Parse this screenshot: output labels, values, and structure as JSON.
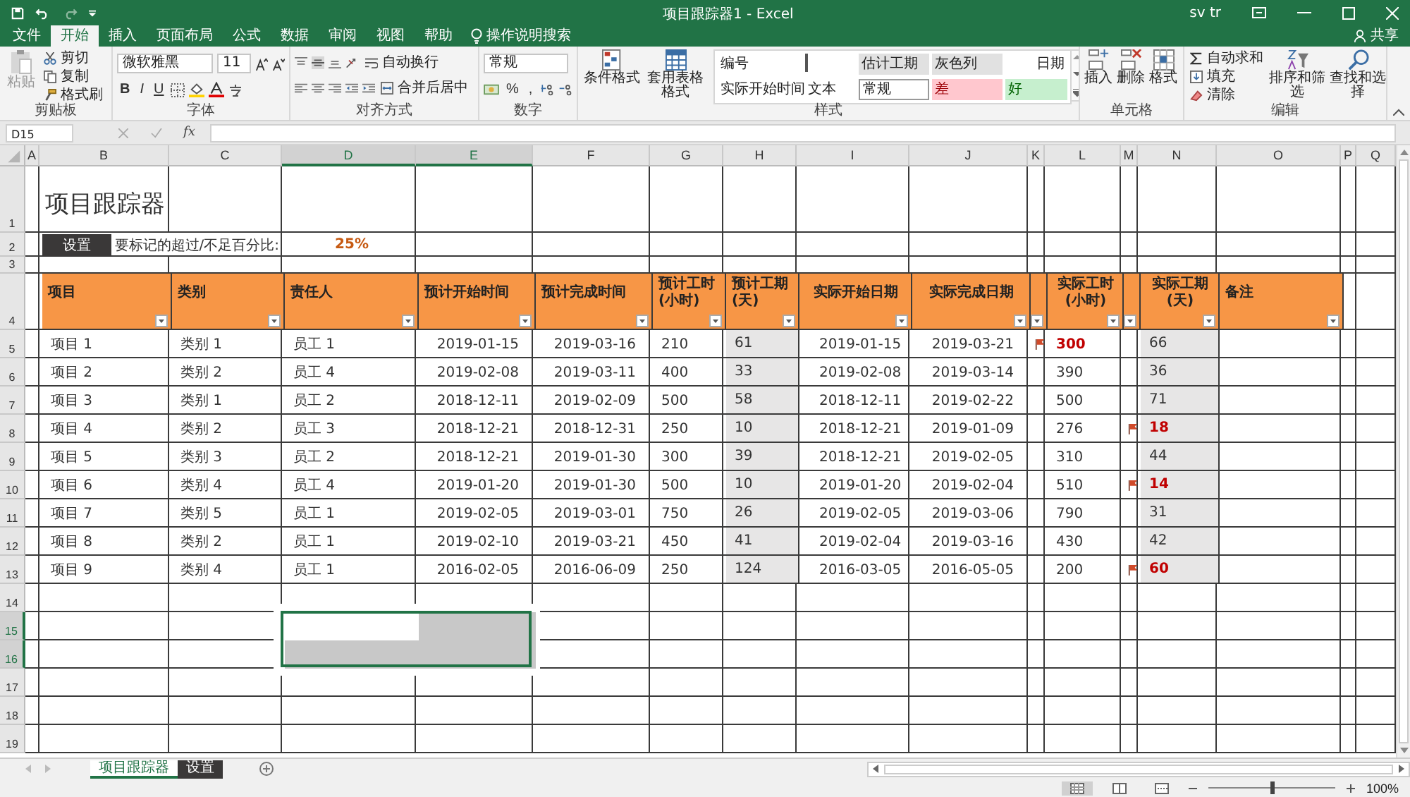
{
  "window": {
    "title": "项目跟踪器1  -  Excel",
    "user": "sv tr"
  },
  "ribbon_tabs": [
    {
      "label": "文件",
      "selected": false
    },
    {
      "label": "开始",
      "selected": true
    },
    {
      "label": "插入",
      "selected": false
    },
    {
      "label": "页面布局",
      "selected": false
    },
    {
      "label": "公式",
      "selected": false
    },
    {
      "label": "数据",
      "selected": false
    },
    {
      "label": "审阅",
      "selected": false
    },
    {
      "label": "视图",
      "selected": false
    },
    {
      "label": "帮助",
      "selected": false
    }
  ],
  "tell_me": "操作说明搜索",
  "share": "共享",
  "ribbon": {
    "clipboard": {
      "paste": {
        "label": "粘贴",
        "disabled": true
      },
      "cut": "剪切",
      "copy": "复制",
      "format_painter": "格式刷",
      "label": "剪贴板"
    },
    "font": {
      "name": "微软雅黑",
      "size": "11",
      "bold": "B",
      "italic": "I",
      "underline": "U",
      "label": "字体"
    },
    "alignment": {
      "wrap": "自动换行",
      "merge": "合并后居中",
      "label": "对齐方式"
    },
    "number": {
      "format": "常规",
      "percent": "%",
      "comma": ",",
      "label": "数字"
    },
    "styles": {
      "conditional": "条件格式",
      "table": "套用表格格式",
      "gallery": [
        {
          "label": "编号",
          "kind": "plain"
        },
        {
          "kind": "marker"
        },
        {
          "label": "估计工期",
          "kind": "gray"
        },
        {
          "label": "灰色列",
          "kind": "gray"
        },
        {
          "label": "日期",
          "kind": "right"
        },
        {
          "label": "实际开始时间",
          "kind": "plain"
        },
        {
          "label": "文本",
          "kind": "plain"
        },
        {
          "label": "常规",
          "kind": "normal"
        },
        {
          "label": "差",
          "kind": "bad"
        },
        {
          "label": "好",
          "kind": "good"
        }
      ],
      "label": "样式"
    },
    "cells": {
      "insert": "插入",
      "delete": "删除",
      "format": "格式",
      "label": "单元格"
    },
    "editing": {
      "autosum": "自动求和",
      "fill": "填充",
      "clear": "清除",
      "sort": "排序和筛选",
      "find": "查找和选择",
      "label": "编辑"
    }
  },
  "formula_bar": {
    "name_box": "D15",
    "function_label": "fx"
  },
  "columns": [
    {
      "letter": "A",
      "selected": false
    },
    {
      "letter": "B",
      "selected": false
    },
    {
      "letter": "C",
      "selected": false
    },
    {
      "letter": "D",
      "selected": true
    },
    {
      "letter": "E",
      "selected": true
    },
    {
      "letter": "F",
      "selected": false
    },
    {
      "letter": "G",
      "selected": false
    },
    {
      "letter": "H",
      "selected": false
    },
    {
      "letter": "I",
      "selected": false
    },
    {
      "letter": "J",
      "selected": false
    },
    {
      "letter": "K",
      "selected": false
    },
    {
      "letter": "L",
      "selected": false
    },
    {
      "letter": "M",
      "selected": false
    },
    {
      "letter": "N",
      "selected": false
    },
    {
      "letter": "O",
      "selected": false
    },
    {
      "letter": "P",
      "selected": false
    },
    {
      "letter": "Q",
      "selected": false
    }
  ],
  "row_numbers": [
    {
      "label": "1",
      "selected": false
    },
    {
      "label": "2",
      "selected": false
    },
    {
      "label": "3",
      "selected": false
    },
    {
      "label": "4",
      "selected": false
    },
    {
      "label": "5",
      "selected": false
    },
    {
      "label": "6",
      "selected": false
    },
    {
      "label": "7",
      "selected": false
    },
    {
      "label": "8",
      "selected": false
    },
    {
      "label": "9",
      "selected": false
    },
    {
      "label": "10",
      "selected": false
    },
    {
      "label": "11",
      "selected": false
    },
    {
      "label": "12",
      "selected": false
    },
    {
      "label": "13",
      "selected": false
    },
    {
      "label": "14",
      "selected": false
    },
    {
      "label": "15",
      "selected": true
    },
    {
      "label": "16",
      "selected": true
    },
    {
      "label": "17",
      "selected": false
    },
    {
      "label": "18",
      "selected": false
    },
    {
      "label": "19",
      "selected": false
    }
  ],
  "sheet": {
    "title": "项目跟踪器",
    "settings_button": "设置",
    "threshold_label": "要标记的超过/不足百分比:",
    "threshold_value": "25%",
    "headers": [
      {
        "label": "项目",
        "kind": "label"
      },
      {
        "label": "类别",
        "kind": "label"
      },
      {
        "label": "责任人",
        "kind": "label"
      },
      {
        "label": "预计开始时间",
        "kind": "label"
      },
      {
        "label": "预计完成时间",
        "kind": "label"
      },
      {
        "label": "预计工时\n(小时)",
        "kind": "label"
      },
      {
        "label": "预计工期\n(天)",
        "kind": "label"
      },
      {
        "label": "实际开始日期",
        "kind": "centered"
      },
      {
        "label": "实际完成日期",
        "kind": "centered"
      },
      {
        "kind": "flag"
      },
      {
        "label": "实际工时\n(小时)",
        "kind": "centered"
      },
      {
        "kind": "flag"
      },
      {
        "label": "实际工期\n(天)",
        "kind": "centered"
      },
      {
        "label": "备注",
        "kind": "label"
      }
    ],
    "rows": [
      {
        "item": "项目 1",
        "category": "类别 1",
        "owner": "员工 1",
        "planned_start": "2019-01-15",
        "planned_end": "2019-03-16",
        "planned_hours": "210",
        "planned_days": "61",
        "actual_start": "2019-01-15",
        "actual_end": "2019-03-21",
        "hours_flag": true,
        "actual_hours": "300",
        "days_flag": false,
        "actual_days": "66"
      },
      {
        "item": "项目 2",
        "category": "类别 2",
        "owner": "员工 4",
        "planned_start": "2019-02-08",
        "planned_end": "2019-03-11",
        "planned_hours": "400",
        "planned_days": "33",
        "actual_start": "2019-02-08",
        "actual_end": "2019-03-14",
        "hours_flag": false,
        "actual_hours": "390",
        "days_flag": false,
        "actual_days": "36"
      },
      {
        "item": "项目 3",
        "category": "类别 1",
        "owner": "员工 2",
        "planned_start": "2018-12-11",
        "planned_end": "2019-02-09",
        "planned_hours": "500",
        "planned_days": "58",
        "actual_start": "2018-12-11",
        "actual_end": "2019-02-22",
        "hours_flag": false,
        "actual_hours": "500",
        "days_flag": false,
        "actual_days": "71"
      },
      {
        "item": "项目 4",
        "category": "类别 2",
        "owner": "员工 3",
        "planned_start": "2018-12-21",
        "planned_end": "2018-12-31",
        "planned_hours": "250",
        "planned_days": "10",
        "actual_start": "2018-12-21",
        "actual_end": "2019-01-09",
        "hours_flag": false,
        "actual_hours": "276",
        "days_flag": true,
        "actual_days": "18"
      },
      {
        "item": "项目 5",
        "category": "类别 3",
        "owner": "员工 2",
        "planned_start": "2018-12-21",
        "planned_end": "2019-01-30",
        "planned_hours": "300",
        "planned_days": "39",
        "actual_start": "2018-12-21",
        "actual_end": "2019-02-05",
        "hours_flag": false,
        "actual_hours": "310",
        "days_flag": false,
        "actual_days": "44"
      },
      {
        "item": "项目 6",
        "category": "类别 4",
        "owner": "员工 4",
        "planned_start": "2019-01-20",
        "planned_end": "2019-01-30",
        "planned_hours": "500",
        "planned_days": "10",
        "actual_start": "2019-01-20",
        "actual_end": "2019-02-04",
        "hours_flag": false,
        "actual_hours": "510",
        "days_flag": true,
        "actual_days": "14"
      },
      {
        "item": "项目 7",
        "category": "类别 5",
        "owner": "员工 1",
        "planned_start": "2019-02-05",
        "planned_end": "2019-03-01",
        "planned_hours": "750",
        "planned_days": "26",
        "actual_start": "2019-02-05",
        "actual_end": "2019-03-06",
        "hours_flag": false,
        "actual_hours": "790",
        "days_flag": false,
        "actual_days": "31"
      },
      {
        "item": "项目 8",
        "category": "类别 2",
        "owner": "员工 1",
        "planned_start": "2019-02-10",
        "planned_end": "2019-03-21",
        "planned_hours": "450",
        "planned_days": "41",
        "actual_start": "2019-02-04",
        "actual_end": "2019-03-16",
        "hours_flag": false,
        "actual_hours": "430",
        "days_flag": false,
        "actual_days": "42"
      },
      {
        "item": "项目 9",
        "category": "类别 4",
        "owner": "员工 1",
        "planned_start": "2016-02-05",
        "planned_end": "2016-06-09",
        "planned_hours": "250",
        "planned_days": "124",
        "actual_start": "2016-03-05",
        "actual_end": "2016-05-05",
        "hours_flag": false,
        "actual_hours": "200",
        "days_flag": true,
        "actual_days": "60"
      }
    ]
  },
  "sheet_tabs": [
    {
      "label": "项目跟踪器",
      "selected": true
    },
    {
      "label": "设置",
      "selected": false
    }
  ],
  "status_bar": {
    "zoom": "100%",
    "zoom_slider": {
      "level": 0.5
    }
  }
}
